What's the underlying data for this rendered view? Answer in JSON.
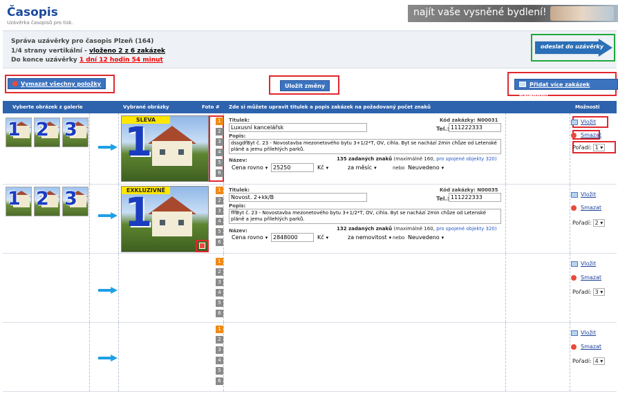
{
  "header": {
    "title": "Časopis",
    "subtitle": "Uzávěrka časopisů pro tisk.",
    "banner_text": "najít vaše vysněné bydlení!"
  },
  "info": {
    "line1": "Správa uzávěrky pro časopis Plzeň (164)",
    "line2_prefix": "1/4 strany vertikální - ",
    "line2_link": "vloženo 2 z 6 zakázek",
    "line3_prefix": "Do konce uzávěrky ",
    "line3_link": "1 dní 12 hodin 54 minut",
    "send_button": "odeslat do uzávěrky"
  },
  "toolbar": {
    "clear_all": "Vymazat všechny položky",
    "save": "Uložit změny",
    "add_more": "Přidat více zakázek najednou"
  },
  "table": {
    "headers": {
      "gallery": "Vyberte obrázek z galerie",
      "selected": "Vybrané obrázky",
      "photo_no": "Foto #",
      "edit": "Zde si můžete upravit titulek a popis zakázek na požadovaný počet znaků",
      "options": "Možnosti"
    },
    "photo_numbers": [
      "1",
      "2",
      "3",
      "4",
      "5",
      "6"
    ],
    "field_labels": {
      "titulek": "Titulek:",
      "tel": "Tel.:",
      "popis": "Popis:",
      "nazev": "Název:",
      "nebo": "nebo"
    },
    "options": {
      "insert": "Vložit",
      "delete": "Smazat",
      "order_label": "Pořadí:"
    },
    "rows": [
      {
        "tag": "SLEVA",
        "code": "Kód zakázky: N00031",
        "title": "Luxusní kancelářsk",
        "tel": "111222333",
        "description": "dssgdfByt č. 23 - Novostavba mezonetového bytu 3+1/2*T, OV, cihla. Byt se nachází 2min chůze od Letenské pláně a jemu přilehlých parků.",
        "chars_bold": "135 zadaných znaků",
        "chars_rest": " (maximálně 160, ",
        "chars_link": "pro spojené objekty 320)",
        "price_type": "Cena rovno",
        "price": "25250",
        "currency": "Kč",
        "period": "za měsíc",
        "other": "Neuvedeno",
        "order": "1"
      },
      {
        "tag": "EXKLUZIVNĚ",
        "code": "Kód zakázky: N00035",
        "title": "Novost. 2+kk/B",
        "tel": "111222333",
        "description": "fffByt č. 23 - Novostavba mezonetového bytu 3+1/2*T, OV, cihla. Byt se nachází 2min chůze od Letenské pláně a jemu přilehlých parků.",
        "chars_bold": "132 zadaných znaků",
        "chars_rest": " (maximálně 160, ",
        "chars_link": "pro spojené objekty 320)",
        "price_type": "Cena rovno",
        "price": "2848000",
        "currency": "Kč",
        "period": "za nemovitost",
        "other": "Neuvedeno",
        "order": "2"
      },
      {
        "order": "3"
      },
      {
        "order": "4"
      }
    ]
  },
  "colors": {
    "accent": "#2d62ad",
    "highlight": "#e0262d",
    "active_number": "#f08a17",
    "send_border": "#1ea83b"
  }
}
